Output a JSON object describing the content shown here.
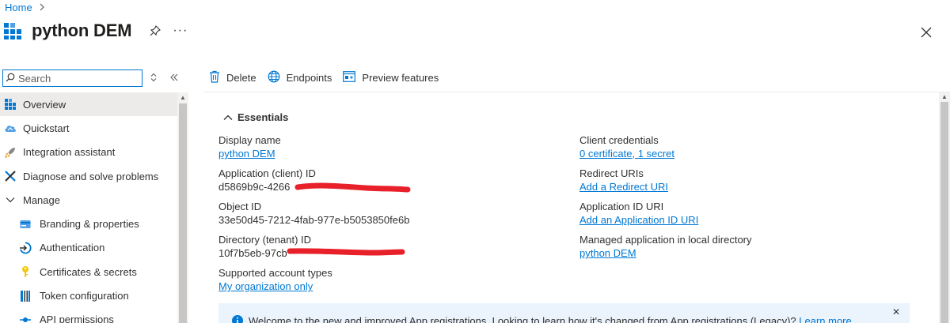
{
  "breadcrumb": {
    "home": "Home",
    "separator": ">"
  },
  "header": {
    "title": "python DEM",
    "more": "···",
    "close_icon": "close-icon",
    "pin_icon": "pin-icon"
  },
  "sidebar": {
    "search_placeholder": "Search",
    "items": [
      {
        "label": "Overview",
        "icon": "grid-icon",
        "active": true
      },
      {
        "label": "Quickstart",
        "icon": "cloud-icon"
      },
      {
        "label": "Integration assistant",
        "icon": "rocket-icon"
      },
      {
        "label": "Diagnose and solve problems",
        "icon": "wrench-icon"
      },
      {
        "label": "Manage",
        "icon": "chevron-down-icon"
      },
      {
        "label": "Branding & properties",
        "icon": "card-icon"
      },
      {
        "label": "Authentication",
        "icon": "login-icon"
      },
      {
        "label": "Certificates & secrets",
        "icon": "key-icon"
      },
      {
        "label": "Token configuration",
        "icon": "bars-icon"
      },
      {
        "label": "API permissions",
        "icon": "api-icon"
      }
    ]
  },
  "toolbar": {
    "delete": "Delete",
    "endpoints": "Endpoints",
    "preview": "Preview features"
  },
  "essentials": {
    "header": "Essentials",
    "display_name": {
      "label": "Display name",
      "value": "python DEM"
    },
    "client_id": {
      "label": "Application (client) ID",
      "value": "d5869b9c-4266"
    },
    "object_id": {
      "label": "Object ID",
      "value": "33e50d45-7212-4fab-977e-b5053850fe6b"
    },
    "tenant_id": {
      "label": "Directory (tenant) ID",
      "value": "10f7b5eb-97cb"
    },
    "account_types": {
      "label": "Supported account types",
      "value": "My organization only"
    },
    "client_credentials": {
      "label": "Client credentials",
      "value": "0 certificate, 1 secret"
    },
    "redirect_uris": {
      "label": "Redirect URIs",
      "value": "Add a Redirect URI"
    },
    "app_id_uri": {
      "label": "Application ID URI",
      "value": "Add an Application ID URI"
    },
    "managed_app": {
      "label": "Managed application in local directory",
      "value": "python DEM"
    }
  },
  "info_bar": {
    "message": "Welcome to the new and improved App registrations. Looking to learn how it's changed from App registrations (Legacy)?",
    "link": "Learn more",
    "close": "✕"
  },
  "colors": {
    "accent": "#0078d4",
    "redaction": "#e8202a",
    "info_bg": "#ebf3fc",
    "active_nav": "#edebe9"
  }
}
